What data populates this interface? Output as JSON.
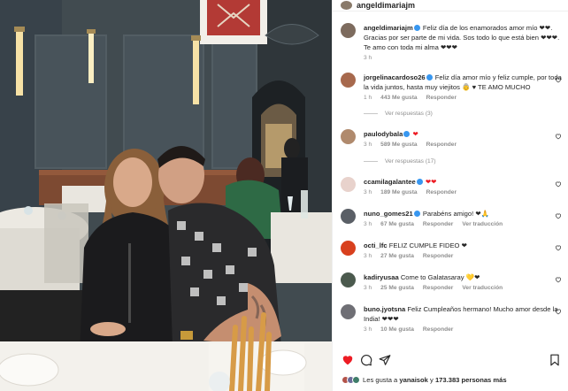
{
  "post": {
    "author": "angeldimariajm"
  },
  "comments": [
    {
      "user": "angeldimariajm",
      "text": "Feliz día de los enamorados amor mío ❤❤. Gracias por ser parte de mi vida. Sos todo lo que está bien ❤❤❤. Te amo con toda mi alma ❤❤❤",
      "time": "3 h",
      "likes": "",
      "reply": ""
    },
    {
      "user": "jorgelinacardoso26",
      "text": "Feliz día amor mío y feliz cumple, por toda la vida juntos, hasta muy viejitos 👵 ♥ TE AMO MUCHO",
      "time": "1 h",
      "likes": "443 Me gusta",
      "reply": "Responder",
      "replies": "Ver respuestas (3)"
    },
    {
      "user": "paulodybala",
      "text": "❤",
      "time": "3 h",
      "likes": "589 Me gusta",
      "reply": "Responder",
      "replies": "Ver respuestas (17)"
    },
    {
      "user": "ccamilagalantee",
      "text": "❤❤",
      "time": "3 h",
      "likes": "189 Me gusta",
      "reply": "Responder"
    },
    {
      "user": "nuno_gomes21",
      "text": "Parabéns amigo! ❤🙏",
      "time": "3 h",
      "likes": "67 Me gusta",
      "reply": "Responder",
      "translate": "Ver traducción"
    },
    {
      "user": "octi_lfc",
      "text": "FELIZ CUMPLE FIDEO ❤",
      "time": "3 h",
      "likes": "27 Me gusta",
      "reply": "Responder"
    },
    {
      "user": "kadiryusaa",
      "text": "Come to Galatasaray 💛❤",
      "time": "3 h",
      "likes": "25 Me gusta",
      "reply": "Responder",
      "translate": "Ver traducción"
    },
    {
      "user": "buno.jyotsna",
      "text": "Feliz Cumpleaños hermano! Mucho amor desde la India! ❤❤❤",
      "time": "3 h",
      "likes": "10 Me gusta",
      "reply": "Responder"
    }
  ],
  "footer": {
    "liked_prefix": "Les gusta a",
    "liked_user": "yanaisok",
    "liked_middle": "y",
    "liked_count": "173.383 personas",
    "liked_suffix": "más"
  },
  "colors": {
    "like_red": "#ed1c24",
    "verified_blue": "#3897f0",
    "muted_text": "#8e8e8e"
  },
  "icons": {
    "like": "heart-icon",
    "comment": "comment-icon",
    "share": "send-icon",
    "save": "bookmark-icon"
  }
}
